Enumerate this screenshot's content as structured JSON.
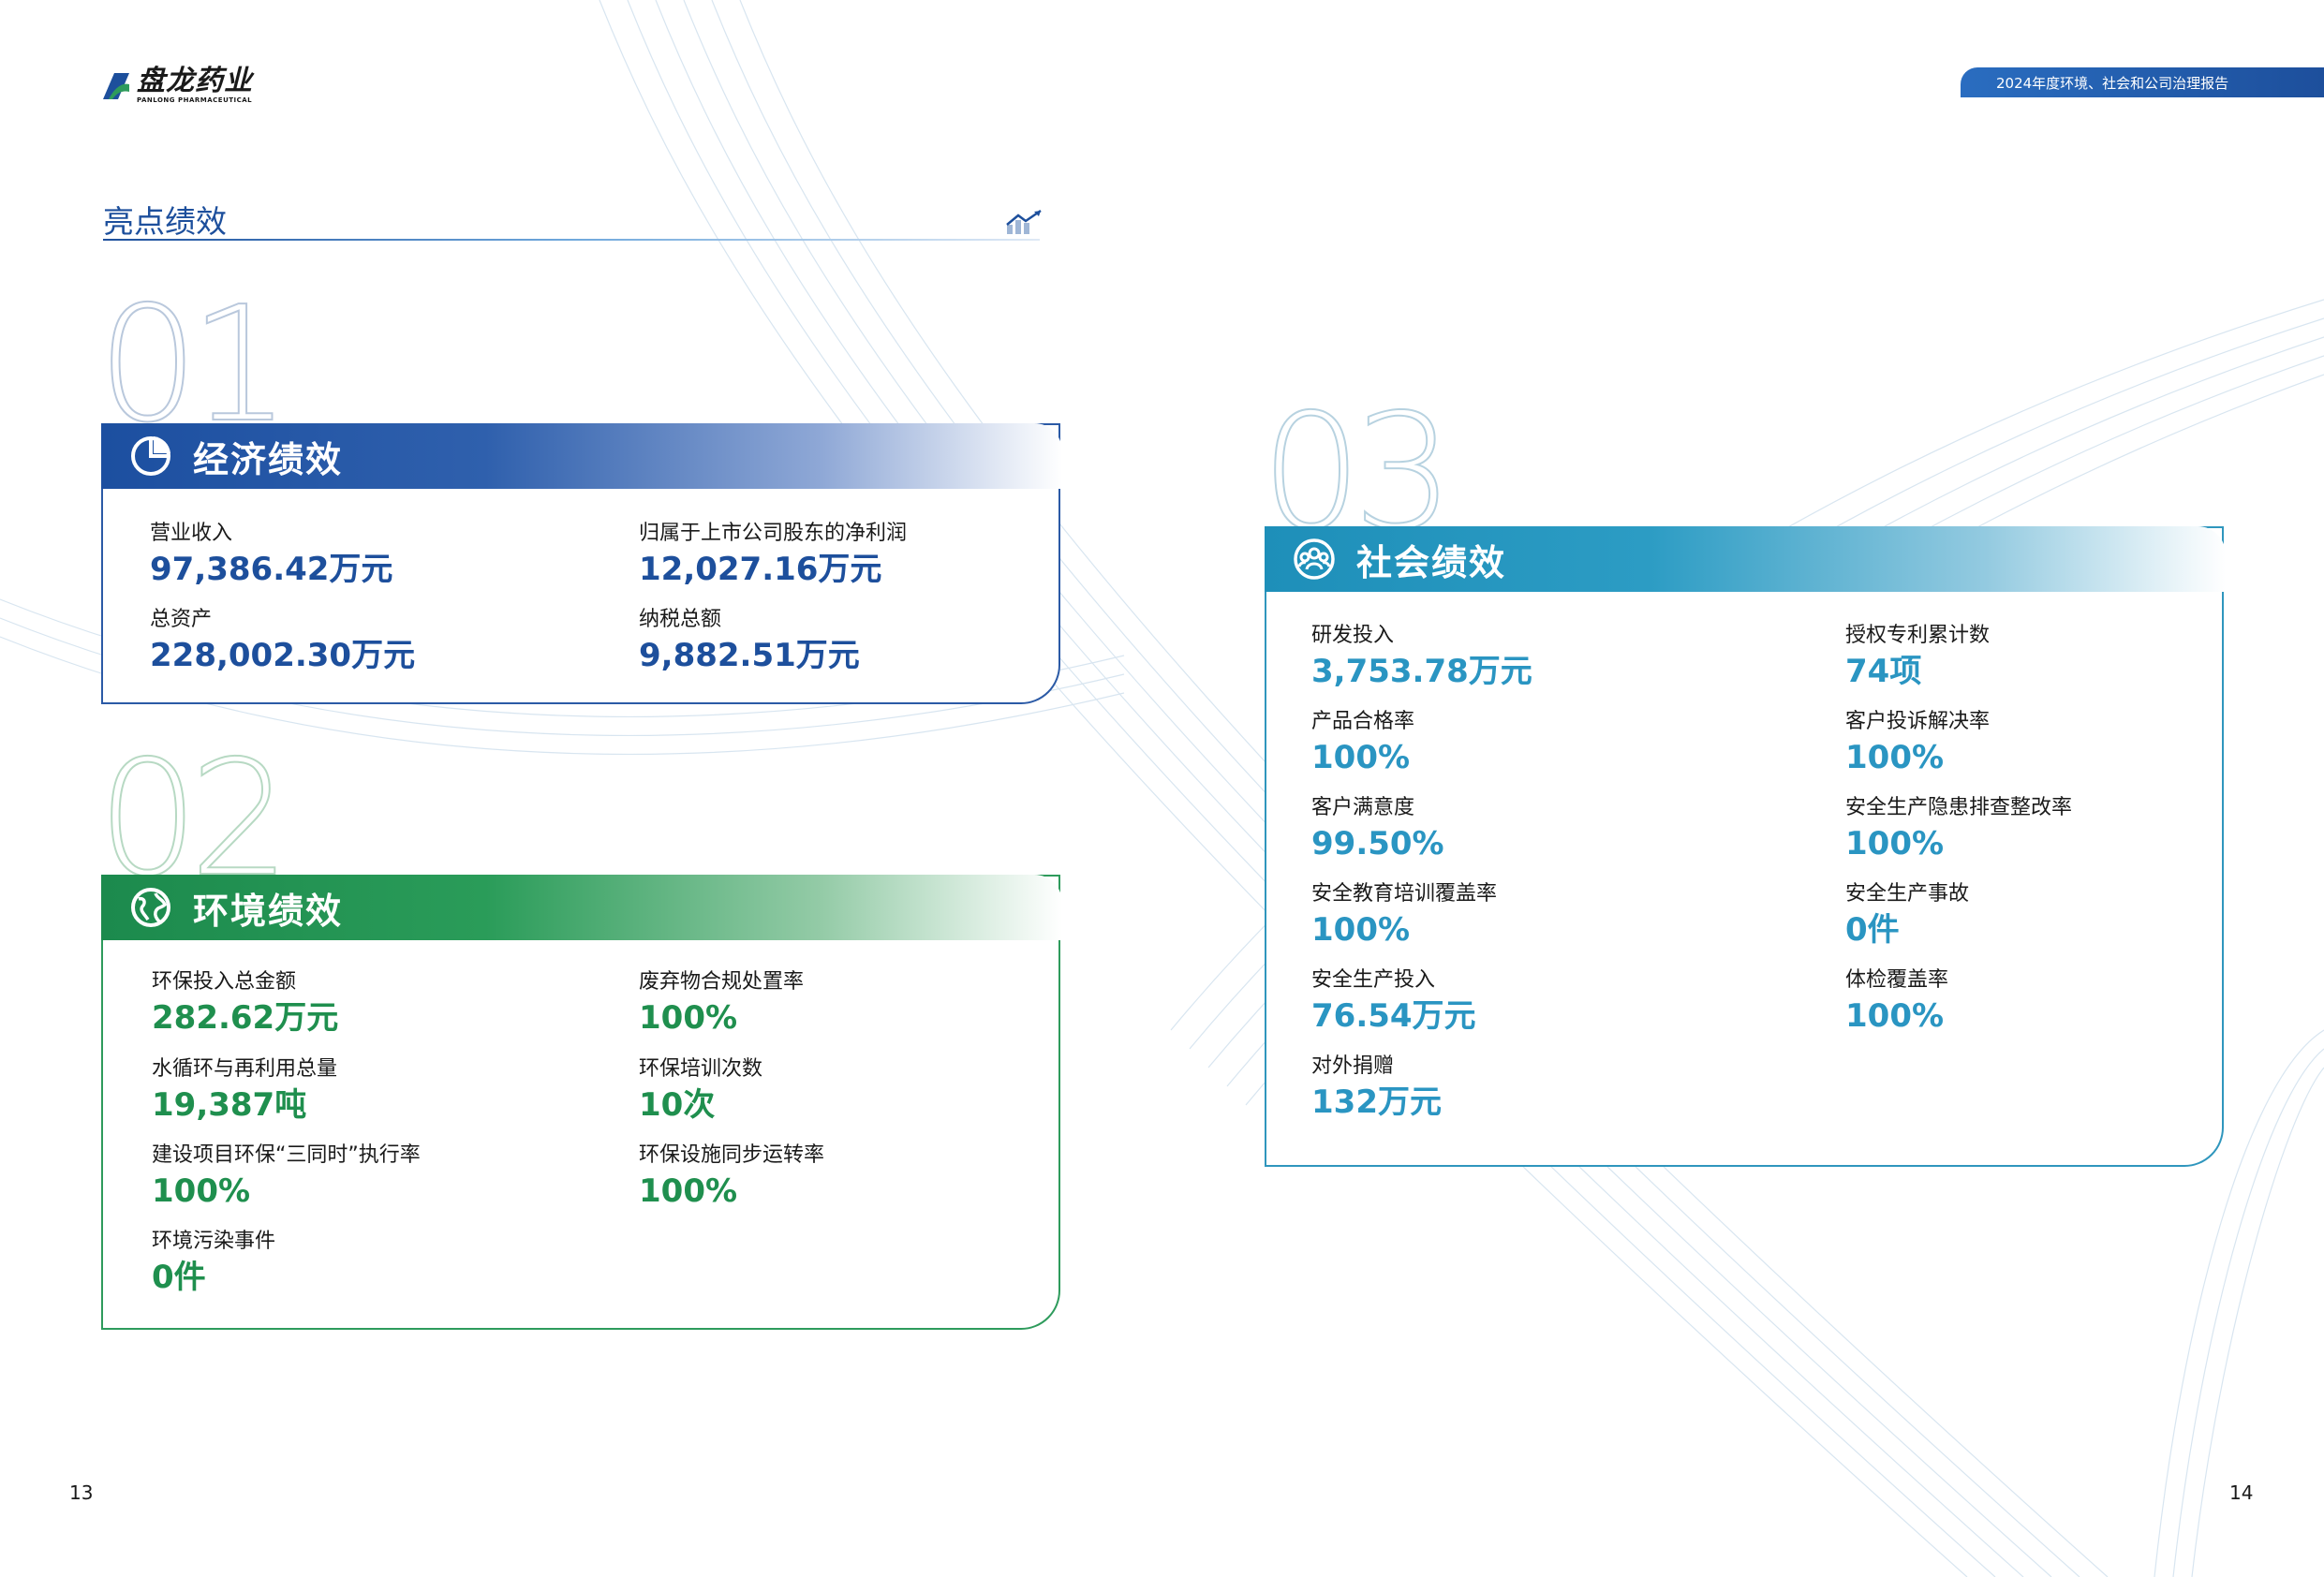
{
  "header": {
    "logo_cn": "盘龙药业",
    "logo_en": "PANLONG PHARMACEUTICAL",
    "report_title": "2024年度环境、社会和公司治理报告"
  },
  "section": {
    "title": "亮点绩效"
  },
  "economic": {
    "number": "01",
    "title": "经济绩效",
    "metrics": [
      {
        "label": "营业收入",
        "value": "97,386.42万元"
      },
      {
        "label": "归属于上市公司股东的净利润",
        "value": "12,027.16万元"
      },
      {
        "label": "总资产",
        "value": "228,002.30万元"
      },
      {
        "label": "纳税总额",
        "value": "9,882.51万元"
      }
    ]
  },
  "environment": {
    "number": "02",
    "title": "环境绩效",
    "metrics": [
      {
        "label": "环保投入总金额",
        "value": "282.62万元"
      },
      {
        "label": "废弃物合规处置率",
        "value": "100%"
      },
      {
        "label": "水循环与再利用总量",
        "value": "19,387吨"
      },
      {
        "label": "环保培训次数",
        "value": "10次"
      },
      {
        "label": "建设项目环保“三同时”执行率",
        "value": "100%"
      },
      {
        "label": "环保设施同步运转率",
        "value": "100%"
      },
      {
        "label": "环境污染事件",
        "value": "0件"
      }
    ]
  },
  "social": {
    "number": "03",
    "title": "社会绩效",
    "metrics": [
      {
        "label": "研发投入",
        "value": "3,753.78万元"
      },
      {
        "label": "授权专利累计数",
        "value": "74项"
      },
      {
        "label": "产品合格率",
        "value": "100%"
      },
      {
        "label": "客户投诉解决率",
        "value": "100%"
      },
      {
        "label": "客户满意度",
        "value": "99.50%"
      },
      {
        "label": "安全生产隐患排查整改率",
        "value": "100%"
      },
      {
        "label": "安全教育培训覆盖率",
        "value": "100%"
      },
      {
        "label": "安全生产事故",
        "value": "0件"
      },
      {
        "label": "安全生产投入",
        "value": "76.54万元"
      },
      {
        "label": "体检覆盖率",
        "value": "100%"
      },
      {
        "label": "对外捐赠",
        "value": "132万元"
      }
    ]
  },
  "page_numbers": {
    "left": "13",
    "right": "14"
  },
  "colors": {
    "blue": "#1d4f9c",
    "green": "#1f8f4e",
    "teal": "#2a95c2"
  }
}
